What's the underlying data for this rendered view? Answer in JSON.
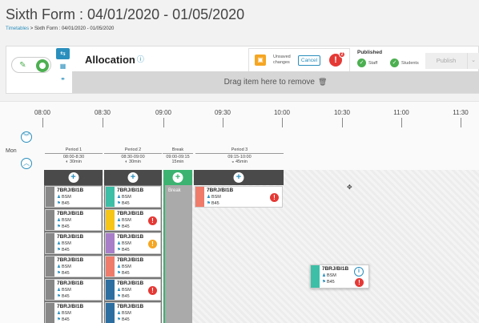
{
  "page": {
    "title": "Sixth Form : 04/01/2020 - 01/05/2020",
    "breadcrumb": {
      "link": "Timetables",
      "separator": " > ",
      "current": "Sixth Form : 04/01/2020 - 01/05/2020"
    }
  },
  "toolbar": {
    "allocation_title": "Allocation",
    "unsaved_text": "Unsaved changes",
    "cancel_label": "Cancel",
    "alert_count": "2",
    "published_title": "Published",
    "staff_label": "Staff",
    "students_label": "Students",
    "publish_label": "Publish",
    "drop_zone_text": "Drag item here to remove"
  },
  "timeline": {
    "labels": [
      "08:00",
      "08:30",
      "09:00",
      "09:30",
      "10:00",
      "10:30",
      "11:00",
      "11:30"
    ],
    "day": "Mon"
  },
  "periods": [
    {
      "name": "Period 1",
      "time": "08:00-8:30",
      "duration": "30min"
    },
    {
      "name": "Period 2",
      "time": "08:30-09:00",
      "duration": "30min"
    },
    {
      "name": "Break",
      "time": "09:00-09:15",
      "duration": "15min"
    },
    {
      "name": "Period 3",
      "time": "09:15-10:00",
      "duration": "45min"
    }
  ],
  "break_label": "Break",
  "cards": {
    "title": "7BRJ/BI1B",
    "subject": "BSM",
    "room": "B45"
  },
  "colors": {
    "accent": "#2a8fbd",
    "green": "#4caf50",
    "orange": "#f5a623",
    "red": "#e53935",
    "teal": "#3cbfa6",
    "yellow": "#f5c518",
    "purple": "#a97ec9",
    "salmon": "#ef7b6b",
    "navy": "#2d6ea1",
    "grey": "#888888"
  },
  "icons": {
    "edit": "pencil-icon",
    "grid": "grid-icon",
    "link": "link-icon",
    "info": "info-icon",
    "save": "save-icon",
    "trash": "trash-icon",
    "check": "check-icon",
    "alert": "alert-icon"
  }
}
